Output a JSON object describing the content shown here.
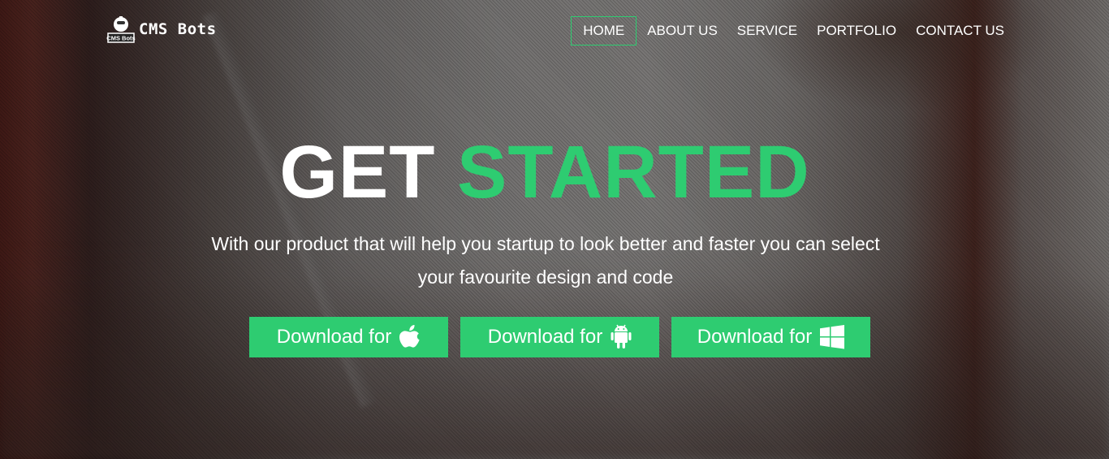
{
  "brand": {
    "name": "CMS Bots",
    "badge": "CMS Bots"
  },
  "nav": {
    "items": [
      {
        "label": "HOME",
        "active": true
      },
      {
        "label": "ABOUT US",
        "active": false
      },
      {
        "label": "SERVICE",
        "active": false
      },
      {
        "label": "PORTFOLIO",
        "active": false
      },
      {
        "label": "CONTACT US",
        "active": false
      }
    ]
  },
  "hero": {
    "headline_white": "GET",
    "headline_green": "STARTED",
    "tagline_line1": "With our product that will help you startup to look better and faster you can select",
    "tagline_line2": "your favourite design and code"
  },
  "downloads": [
    {
      "label": "Download for",
      "icon": "apple-icon"
    },
    {
      "label": "Download for",
      "icon": "android-icon"
    },
    {
      "label": "Download for",
      "icon": "windows-icon"
    }
  ],
  "colors": {
    "accent": "#2ecc71",
    "text": "#ffffff"
  }
}
